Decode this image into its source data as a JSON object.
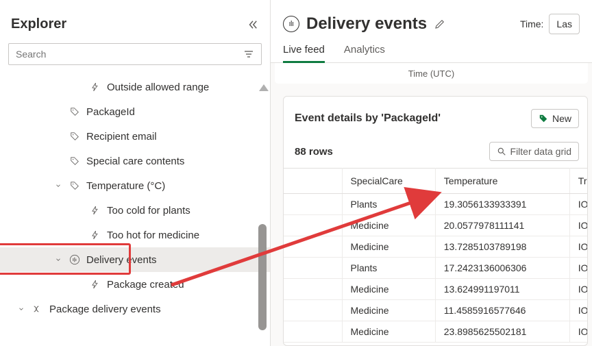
{
  "sidebar": {
    "title": "Explorer",
    "search_placeholder": "Search",
    "items": [
      {
        "label": "Outside allowed range",
        "icon": "bolt",
        "depth": 3
      },
      {
        "label": "PackageId",
        "icon": "tag",
        "depth": 2
      },
      {
        "label": "Recipient email",
        "icon": "tag",
        "depth": 2
      },
      {
        "label": "Special care contents",
        "icon": "tag",
        "depth": 2
      },
      {
        "label": "Temperature (°C)",
        "icon": "tag",
        "depth": 2,
        "chev": "down"
      },
      {
        "label": "Too cold for plants",
        "icon": "bolt",
        "depth": 3
      },
      {
        "label": "Too hot for medicine",
        "icon": "bolt",
        "depth": 3
      },
      {
        "label": "Delivery events",
        "icon": "stream",
        "depth": 2,
        "chev": "down",
        "selected": true,
        "highlighted": true
      },
      {
        "label": "Package created",
        "icon": "bolt",
        "depth": 3
      },
      {
        "label": "Package delivery events",
        "icon": "flow",
        "depth": 0,
        "chev": "down"
      }
    ]
  },
  "header": {
    "title": "Delivery events",
    "time_label": "Time:",
    "time_value": "Las"
  },
  "tabs": [
    {
      "label": "Live feed",
      "active": true
    },
    {
      "label": "Analytics",
      "active": false
    }
  ],
  "time_strip": "Time (UTC)",
  "panel": {
    "title": "Event details by 'PackageId'",
    "new_label": "New",
    "rowcount": "88 rows",
    "filter_placeholder": "Filter data grid",
    "columns": [
      "",
      "SpecialCare",
      "Temperature",
      "Tracking"
    ],
    "rows": [
      {
        "c1": "",
        "c2": "Plants",
        "c3": "19.3056133933391",
        "c4": "IOT"
      },
      {
        "c1": "",
        "c2": "Medicine",
        "c3": "20.0577978111141",
        "c4": "IOT"
      },
      {
        "c1": "",
        "c2": "Medicine",
        "c3": "13.7285103789198",
        "c4": "IOT"
      },
      {
        "c1": "",
        "c2": "Plants",
        "c3": "17.2423136006306",
        "c4": "IOT"
      },
      {
        "c1": "",
        "c2": "Medicine",
        "c3": "13.624991197011",
        "c4": "IOT"
      },
      {
        "c1": "",
        "c2": "Medicine",
        "c3": "11.4585916577646",
        "c4": "IOT"
      },
      {
        "c1": "",
        "c2": "Medicine",
        "c3": "23.8985625502181",
        "c4": "IOT"
      }
    ]
  }
}
